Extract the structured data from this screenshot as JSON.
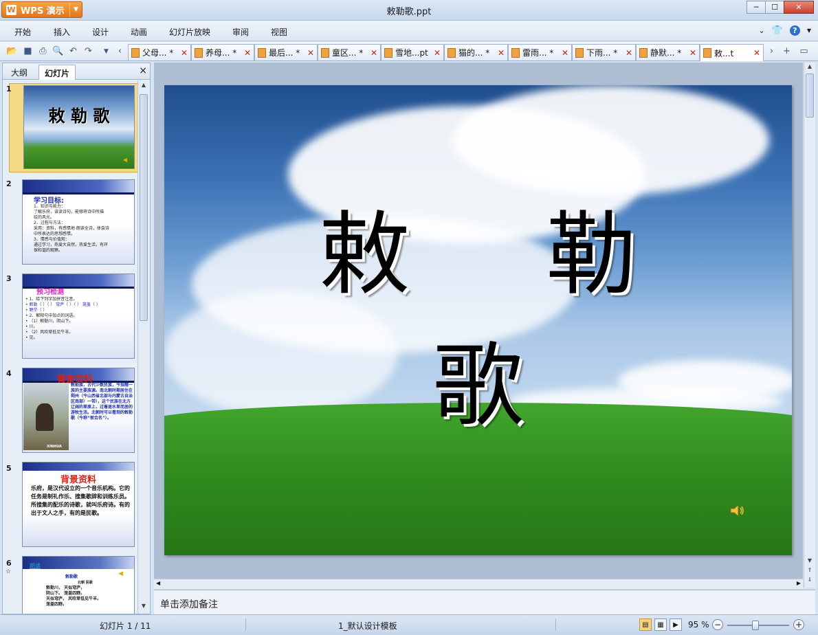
{
  "app": {
    "name": "WPS 演示",
    "window_title": "敕勒歌.ppt"
  },
  "menu": [
    "开始",
    "插入",
    "设计",
    "动画",
    "幻灯片放映",
    "审阅",
    "视图"
  ],
  "tabs": [
    {
      "label": "父母... *"
    },
    {
      "label": "养母... *"
    },
    {
      "label": "最后... *"
    },
    {
      "label": "童区... *"
    },
    {
      "label": "雪地...pt"
    },
    {
      "label": "猫的... *"
    },
    {
      "label": "雷雨... *"
    },
    {
      "label": "下雨... *"
    },
    {
      "label": "静默... *"
    },
    {
      "label": "敕...t"
    }
  ],
  "left_panel": {
    "tab_outline": "大纲",
    "tab_slides": "幻灯片",
    "close": "×",
    "slides": [
      {
        "num": "1",
        "title": "敕 勒 歌"
      },
      {
        "num": "2",
        "title": "学习目标:",
        "lines": [
          "1、知识与能力：",
          "了解乐府，该读诗句，能够将诗中所描",
          "绘的风光。",
          "2、过程与方法：",
          "采用：资料，有感情地 朗读全诗，体会诗",
          "中所表达的思想感情。",
          "3、情感与价值观：",
          "通过学习，热爱大自然，热爱生活，有环",
          "保和谐的观察。"
        ]
      },
      {
        "num": "3",
        "title": "预习检测",
        "lines": [
          "• 1、给下列字加拼音注音。",
          "• 敕勒（ ）（ ）  穹庐（ ）（ ）  笼盖（ ）",
          "• 野茫（ ）",
          "• 2、解释句中加点的词语。",
          "• （1）敕勒川，阴山下。",
          "•         川。",
          "• （2）风吹草低见牛羊。",
          "•         见。"
        ]
      },
      {
        "num": "4",
        "title": "背景资料",
        "lines": [
          "敕勒族，古代少数民族，今指哪一族的主要族源。南北朝时期居住在朔州（今山西省北部与内蒙古自治区南部）一带），这个民族在北方辽阔的草原上，过着逐水草而居的游牧生活。北朝时可以看到的敕勒歌（今称“家合名”）。"
        ],
        "photo_caption": "XINHUA"
      },
      {
        "num": "5",
        "title": "背景资料",
        "lines": [
          "乐府，是汉代设立的一个音乐机构。它的任务是制礼作乐、搜集歌辞和训练乐员。所搜集的配乐的诗歌，就叫乐府诗。有的出于文人之手，有的是民歌。"
        ]
      },
      {
        "num": "6",
        "title": "朗读",
        "lines": [
          "敕勒歌",
          "北朝 民歌",
          "敕勒川，   天似穹庐，",
          "阴山下。   笼盖四野。",
          "天似穹庐，  风吹草低见牛羊。",
          "笼盖四野。"
        ]
      }
    ]
  },
  "slide": {
    "title": "敕 勒 歌"
  },
  "notes_placeholder": "单击添加备注",
  "status": {
    "slide_counter": "幻灯片 1 / 11",
    "theme": "1_默认设计模板",
    "zoom": "95 %"
  },
  "colors": {
    "accent": "#e4751b",
    "chrome": "#d6e3f2"
  }
}
